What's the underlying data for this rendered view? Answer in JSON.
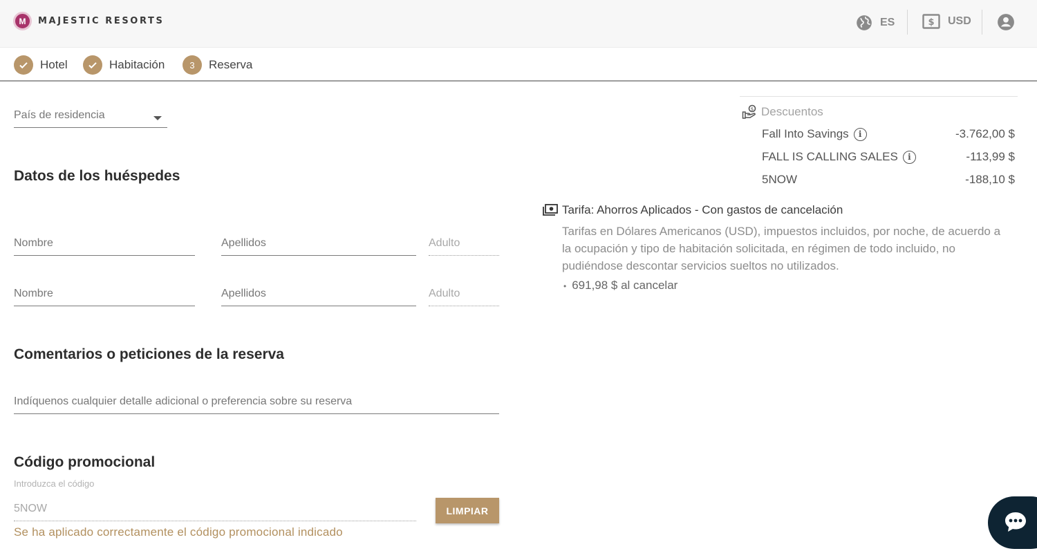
{
  "brand": {
    "name": "MAJESTIC RESORTS",
    "initial": "M"
  },
  "header": {
    "language": "ES",
    "currency": "USD"
  },
  "steps": [
    {
      "label": "Hotel",
      "state": "done"
    },
    {
      "label": "Habitación",
      "state": "done"
    },
    {
      "label": "Reserva",
      "number": "3",
      "state": "current"
    }
  ],
  "form": {
    "country_label": "País de residencia",
    "guests_title": "Datos de los huéspedes",
    "guests": [
      {
        "first": "Nombre",
        "last": "Apellidos",
        "type": "Adulto"
      },
      {
        "first": "Nombre",
        "last": "Apellidos",
        "type": "Adulto"
      }
    ],
    "comments_title": "Comentarios o peticiones de la reserva",
    "comments_placeholder": "Indíquenos cualquier detalle adicional o preferencia sobre su reserva",
    "promo_title": "Código promocional",
    "promo_label": "Introduzca el código",
    "promo_value": "5NOW",
    "clear_label": "LIMPIAR",
    "promo_success": "Se ha aplicado correctamente el código promocional indicado"
  },
  "summary": {
    "discounts_title": "Descuentos",
    "discounts": [
      {
        "name": "Fall Into Savings",
        "amount": "-3.762,00 $",
        "info": true
      },
      {
        "name": "FALL IS CALLING SALES",
        "amount": "-113,99 $",
        "info": true
      },
      {
        "name": "5NOW",
        "amount": "-188,10 $",
        "info": false
      }
    ],
    "rate_title": "Tarifa: Ahorros Aplicados - Con gastos de cancelación",
    "rate_description": "Tarifas en Dólares Americanos (USD), impuestos incluidos, por noche, de acuerdo a la ocupación y tipo de habitación solicitada, en régimen de todo incluido, no pudiéndose descontar servicios sueltos no utilizados.",
    "cancel_fee": "691,98 $ al cancelar"
  },
  "colors": {
    "accent": "#b8966a",
    "chat": "#0e2433",
    "brand": "#a8336a"
  }
}
